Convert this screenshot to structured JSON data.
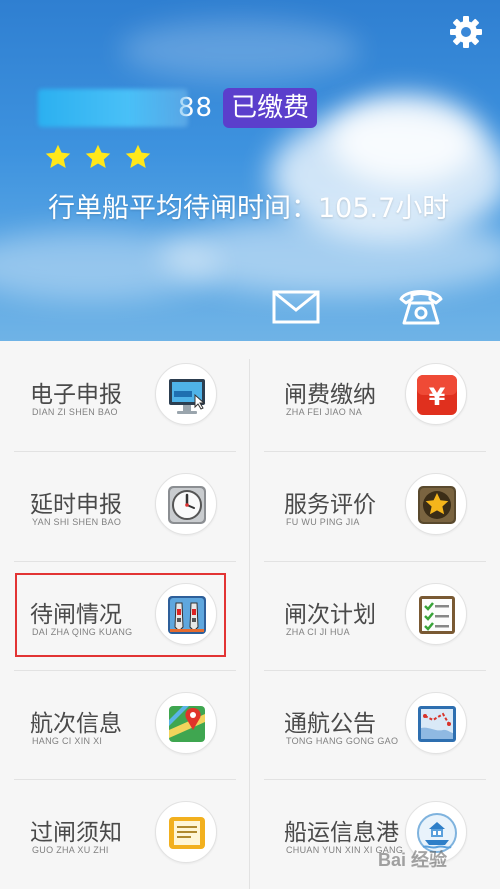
{
  "header": {
    "account_tail": "88",
    "paid_badge": "已缴费",
    "star_count": 3,
    "wait_time_text": "行单船平均待闸时间：105.7小时"
  },
  "menu": [
    {
      "title": "电子申报",
      "pinyin": "DIAN ZI SHEN BAO",
      "icon": "monitor-icon"
    },
    {
      "title": "闸费缴纳",
      "pinyin": "ZHA FEI JIAO NA",
      "icon": "yen-icon"
    },
    {
      "title": "延时申报",
      "pinyin": "YAN SHI SHEN BAO",
      "icon": "clock-icon"
    },
    {
      "title": "服务评价",
      "pinyin": "FU WU PING JIA",
      "icon": "star-badge-icon"
    },
    {
      "title": "待闸情况",
      "pinyin": "DAI ZHA QING KUANG",
      "icon": "ships-icon"
    },
    {
      "title": "闸次计划",
      "pinyin": "ZHA CI JI HUA",
      "icon": "checklist-icon"
    },
    {
      "title": "航次信息",
      "pinyin": "HANG CI XIN XI",
      "icon": "map-pin-icon"
    },
    {
      "title": "通航公告",
      "pinyin": "TONG HANG GONG GAO",
      "icon": "route-map-icon"
    },
    {
      "title": "过闸须知",
      "pinyin": "GUO ZHA XU ZHI",
      "icon": "document-icon"
    },
    {
      "title": "船运信息港",
      "pinyin": "CHUAN YUN XIN XI GANG",
      "icon": "port-icon"
    }
  ],
  "watermark": "Bai 经验"
}
